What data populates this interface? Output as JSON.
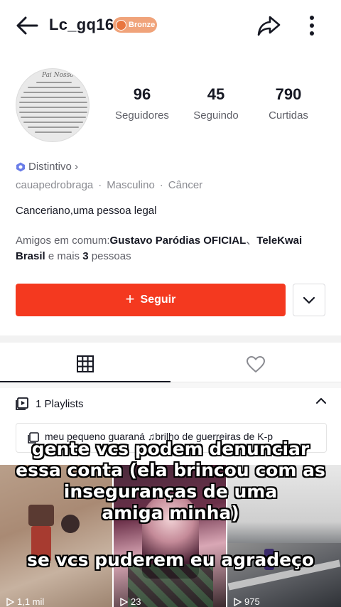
{
  "header": {
    "username": "Lc_gq16",
    "badge_label": "Bronze"
  },
  "stats": [
    {
      "value": "96",
      "label": "Seguidores"
    },
    {
      "value": "45",
      "label": "Seguindo"
    },
    {
      "value": "790",
      "label": "Curtidas"
    }
  ],
  "profile": {
    "badge_link": "Distintivo ›",
    "meta": [
      "cauapedrobraga",
      "Masculino",
      "Câncer"
    ],
    "bio": "Canceriano,uma pessoa legal",
    "friends_prefix": "Amigos em comum:",
    "friends_names_1": "Gustavo Paródias OFICIAL",
    "friends_sep": "、",
    "friends_names_2": "TeleKwai",
    "friends_names_3": "Brasil",
    "friends_mid": " e mais ",
    "friends_count": "3",
    "friends_suffix": " pessoas"
  },
  "actions": {
    "follow_label": "Seguir"
  },
  "playlists": {
    "header": "1 Playlists",
    "item": "meu pequeno guaraná ♫brilho de guerreiras de K-p"
  },
  "videos": [
    {
      "views": "1,1 mil"
    },
    {
      "views": "23"
    },
    {
      "views": "975"
    }
  ],
  "overlay_caption": {
    "line1": "gente vcs podem denunciar",
    "line2": "essa conta (ela brincou com as",
    "line3": "inseguranças de uma",
    "line4": "amiga minha)",
    "line5": "se vcs puderem eu agradeço"
  },
  "colors": {
    "accent": "#f4391f",
    "badge": "#f0a37a",
    "text_primary": "#161823",
    "text_secondary": "#5f6068"
  }
}
